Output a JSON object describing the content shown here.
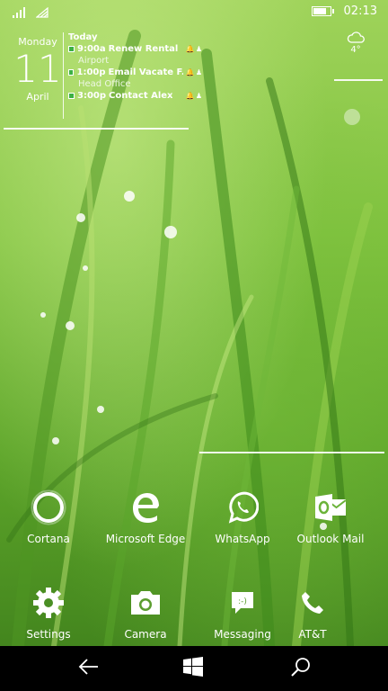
{
  "status_bar": {
    "time": "02:13",
    "battery_level": 0.7
  },
  "calendar": {
    "weekday": "Monday",
    "day": "11",
    "month": "April",
    "agenda_title": "Today",
    "events": [
      {
        "time": "9:00a",
        "title": "Renew Rental",
        "location": "Airport"
      },
      {
        "time": "1:00p",
        "title": "Email Vacate F...",
        "location": "Head Office"
      },
      {
        "time": "3:00p",
        "title": "Contact Alex",
        "location": ""
      }
    ]
  },
  "weather": {
    "icon": "cloud-icon",
    "temperature": "4°"
  },
  "apps": [
    {
      "label": "Cortana",
      "icon": "cortana-icon"
    },
    {
      "label": "Microsoft Edge",
      "icon": "edge-icon"
    },
    {
      "label": "WhatsApp",
      "icon": "whatsapp-icon"
    },
    {
      "label": "Outlook Mail",
      "icon": "outlook-mail-icon"
    },
    {
      "label": "Settings",
      "icon": "gear-icon"
    },
    {
      "label": "Camera",
      "icon": "camera-icon"
    },
    {
      "label": "Messaging",
      "icon": "messaging-icon"
    },
    {
      "label": "AT&T",
      "icon": "phone-icon"
    }
  ],
  "nav_bar": [
    "back-icon",
    "windows-start-icon",
    "search-icon"
  ]
}
